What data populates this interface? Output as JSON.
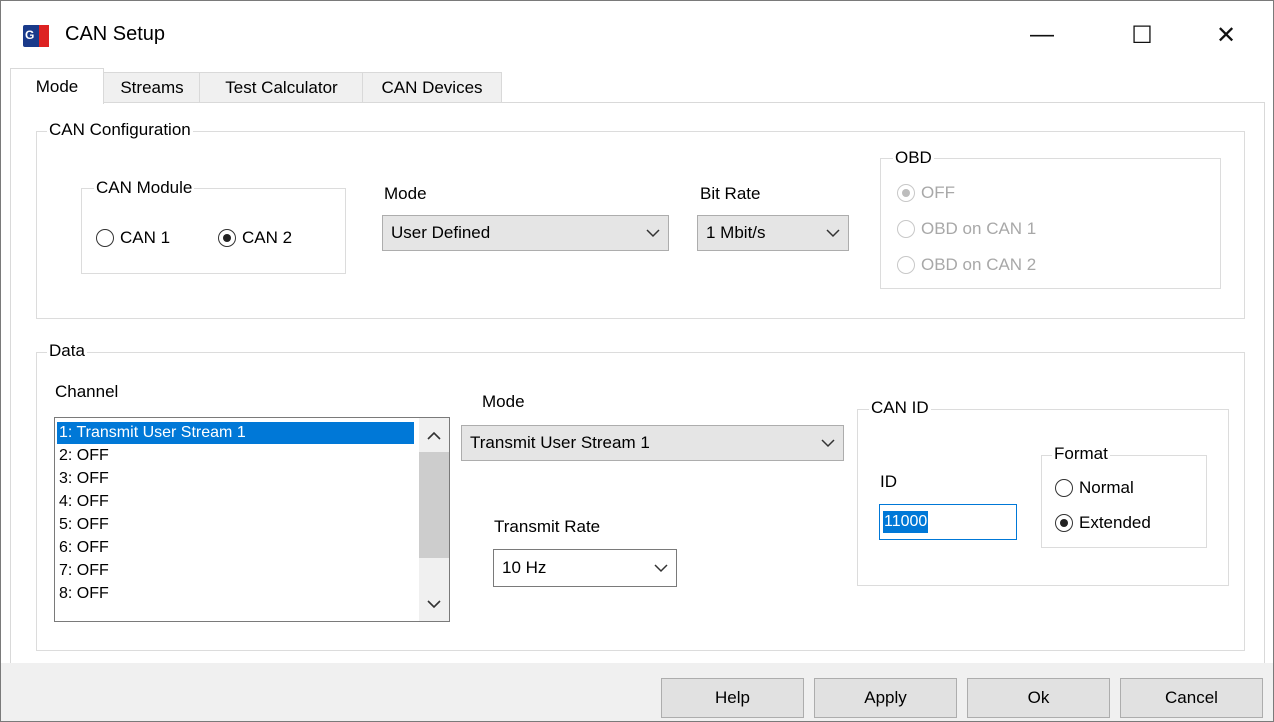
{
  "window": {
    "title": "CAN Setup"
  },
  "titlebar": {
    "minimize_glyph": "—",
    "maximize_glyph": "☐",
    "close_glyph": "✕"
  },
  "tabs": [
    {
      "label": "Mode",
      "active": true
    },
    {
      "label": "Streams",
      "active": false
    },
    {
      "label": "Test Calculator",
      "active": false
    },
    {
      "label": "CAN Devices",
      "active": false
    }
  ],
  "can_config": {
    "group_label": "CAN Configuration",
    "module": {
      "group_label": "CAN Module",
      "options": [
        {
          "label": "CAN 1",
          "selected": false
        },
        {
          "label": "CAN 2",
          "selected": true
        }
      ]
    },
    "mode": {
      "label": "Mode",
      "value": "User Defined"
    },
    "bit_rate": {
      "label": "Bit Rate",
      "value": "1 Mbit/s"
    },
    "obd": {
      "group_label": "OBD",
      "options": [
        {
          "label": "OFF",
          "selected": true
        },
        {
          "label": "OBD on CAN 1",
          "selected": false
        },
        {
          "label": "OBD on CAN 2",
          "selected": false
        }
      ]
    }
  },
  "data": {
    "group_label": "Data",
    "channel": {
      "label": "Channel",
      "items": [
        "1: Transmit User Stream 1",
        "2: OFF",
        "3: OFF",
        "4: OFF",
        "5: OFF",
        "6: OFF",
        "7: OFF",
        "8: OFF"
      ],
      "selected_index": 0
    },
    "mode": {
      "label": "Mode",
      "value": "Transmit User Stream 1"
    },
    "transmit_rate": {
      "label": "Transmit Rate",
      "value": "10 Hz"
    },
    "can_id": {
      "group_label": "CAN ID",
      "id_label": "ID",
      "id_value": "11000",
      "format": {
        "group_label": "Format",
        "options": [
          {
            "label": "Normal",
            "selected": false
          },
          {
            "label": "Extended",
            "selected": true
          }
        ]
      }
    }
  },
  "buttons": {
    "help": "Help",
    "apply": "Apply",
    "ok": "Ok",
    "cancel": "Cancel"
  },
  "colors": {
    "selection": "#0078d7",
    "disabled_text": "#a8a8a8",
    "button_face": "#e1e1e1"
  }
}
